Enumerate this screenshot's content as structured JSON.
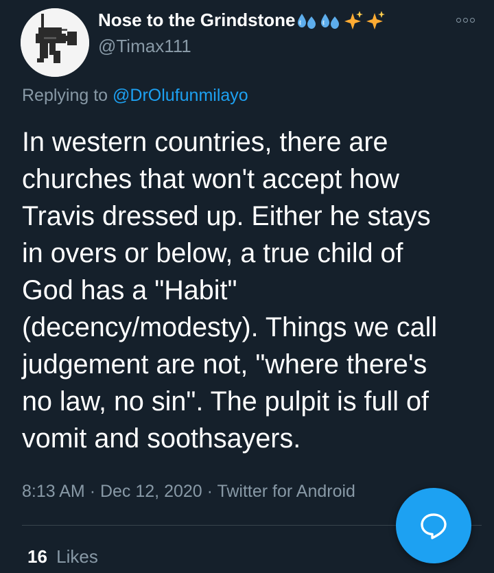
{
  "tweet": {
    "display_name": "Nose to the Grindstone",
    "name_emojis": [
      "sweat-droplets",
      "sweat-droplets",
      "sparkles",
      "sparkles"
    ],
    "handle": "@Timax111",
    "replying_prefix": "Replying to",
    "replying_to": "@DrOlufunmilayo",
    "text": "In western countries, there are\nchurches that won't accept how\nTravis dressed up. Either he stays\nin overs or below, a true child of\nGod has a \"Habit\"\n(decency/modesty). Things we call\njudgement are not, \"where there's\nno law, no sin\". The pulpit is full of\nvomit and soothsayers.",
    "time": "8:13 AM",
    "separator": "·",
    "date": "Dec 12, 2020",
    "source": "Twitter for Android",
    "likes_count": "16",
    "likes_label": "Likes"
  },
  "icons": {
    "more": "more-options-icon",
    "compose": "compose-reply-icon",
    "avatar": "rifle-avatar-image"
  },
  "colors": {
    "background": "#15202b",
    "accent": "#1da1f2",
    "secondary_text": "#8899a6",
    "divider": "#38444d"
  }
}
